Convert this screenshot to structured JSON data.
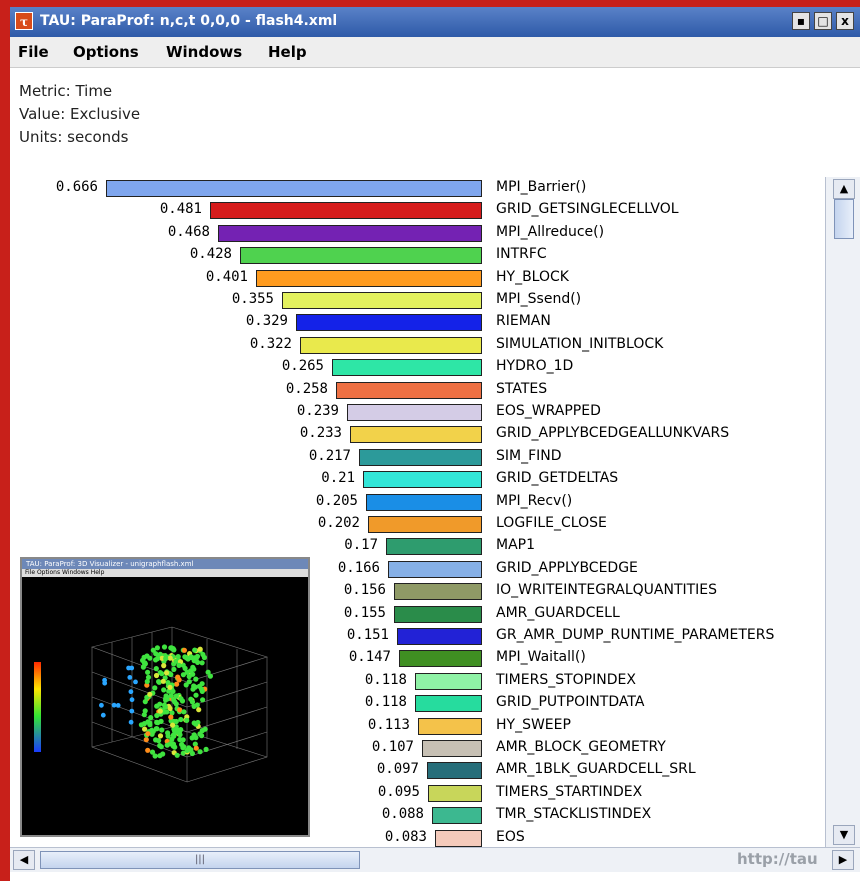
{
  "window": {
    "title": "TAU: ParaProf: n,c,t 0,0,0 - flash4.xml",
    "icon": "tau-icon",
    "buttons": [
      "▪",
      "□",
      "x"
    ]
  },
  "menu": [
    "File",
    "Options",
    "Windows",
    "Help"
  ],
  "header": {
    "metric": "Metric: Time",
    "value": "Value: Exclusive",
    "units": "Units: seconds"
  },
  "chart_data": {
    "type": "bar",
    "orientation": "horizontal",
    "max": 0.666,
    "bars": [
      {
        "label": "MPI_Barrier()",
        "value": "0.666",
        "color": "#7fa6ee"
      },
      {
        "label": "GRID_GETSINGLECELLVOL",
        "value": "0.481",
        "color": "#d61c1c"
      },
      {
        "label": "MPI_Allreduce()",
        "value": "0.468",
        "color": "#7422b3"
      },
      {
        "label": "INTRFC",
        "value": "0.428",
        "color": "#4fd24f"
      },
      {
        "label": "HY_BLOCK",
        "value": "0.401",
        "color": "#ff9b1f"
      },
      {
        "label": "MPI_Ssend()",
        "value": "0.355",
        "color": "#e3f15e"
      },
      {
        "label": "RIEMAN",
        "value": "0.329",
        "color": "#1422e8"
      },
      {
        "label": "SIMULATION_INITBLOCK",
        "value": "0.322",
        "color": "#e9e94c"
      },
      {
        "label": "HYDRO_1D",
        "value": "0.265",
        "color": "#2ee6a6"
      },
      {
        "label": "STATES",
        "value": "0.258",
        "color": "#ee7043"
      },
      {
        "label": "EOS_WRAPPED",
        "value": "0.239",
        "color": "#d4cce6"
      },
      {
        "label": "GRID_APPLYBCEDGEALLUNKVARS",
        "value": "0.233",
        "color": "#f2d24a"
      },
      {
        "label": "SIM_FIND",
        "value": "0.217",
        "color": "#2c9a9a"
      },
      {
        "label": "GRID_GETDELTAS",
        "value": "0.21",
        "color": "#33e6d8"
      },
      {
        "label": "MPI_Recv()",
        "value": "0.205",
        "color": "#1a8ee6"
      },
      {
        "label": "LOGFILE_CLOSE",
        "value": "0.202",
        "color": "#f09a2a"
      },
      {
        "label": "MAP1",
        "value": "0.17",
        "color": "#2e9c6e"
      },
      {
        "label": "GRID_APPLYBCEDGE",
        "value": "0.166",
        "color": "#86b0e6"
      },
      {
        "label": "IO_WRITEINTEGRALQUANTITIES",
        "value": "0.156",
        "color": "#8f9a66"
      },
      {
        "label": "AMR_GUARDCELL",
        "value": "0.155",
        "color": "#2a8c4a"
      },
      {
        "label": "GR_AMR_DUMP_RUNTIME_PARAMETERS",
        "value": "0.151",
        "color": "#2222d6"
      },
      {
        "label": "MPI_Waitall()",
        "value": "0.147",
        "color": "#3f8f22"
      },
      {
        "label": "TIMERS_STOPINDEX",
        "value": "0.118",
        "color": "#8ff2a6"
      },
      {
        "label": "GRID_PUTPOINTDATA",
        "value": "0.118",
        "color": "#26dc9e"
      },
      {
        "label": "HY_SWEEP",
        "value": "0.113",
        "color": "#f4c24a"
      },
      {
        "label": "AMR_BLOCK_GEOMETRY",
        "value": "0.107",
        "color": "#c7c0b4"
      },
      {
        "label": "AMR_1BLK_GUARDCELL_SRL",
        "value": "0.097",
        "color": "#266e7a"
      },
      {
        "label": "TIMERS_STARTINDEX",
        "value": "0.095",
        "color": "#c8d65a"
      },
      {
        "label": "TMR_STACKLISTINDEX",
        "value": "0.088",
        "color": "#3cb890"
      },
      {
        "label": "EOS",
        "value": "0.083",
        "color": "#f4cabb"
      }
    ]
  },
  "inset": {
    "title": "TAU: ParaProf: 3D Visualizer - unigraphflash.xml",
    "menu": "File   Options   Windows   Help"
  },
  "watermark": "http://tau"
}
